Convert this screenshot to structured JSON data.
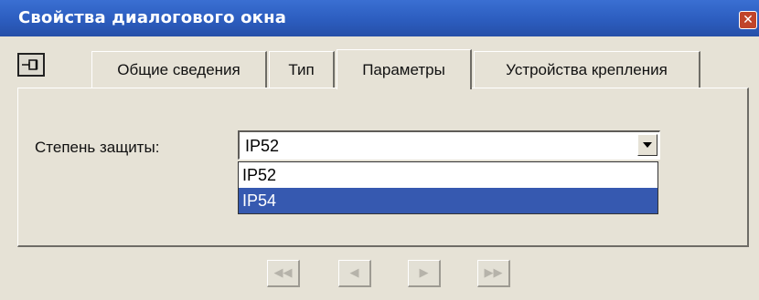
{
  "window": {
    "title": "Свойства диалогового окна",
    "close_icon": "close-icon",
    "pin_icon": "pin-icon"
  },
  "tabs": [
    {
      "label": "Общие сведения",
      "active": false
    },
    {
      "label": "Тип",
      "active": false
    },
    {
      "label": "Параметры",
      "active": true
    },
    {
      "label": "Устройства крепления",
      "active": false
    }
  ],
  "protection": {
    "label": "Степень защиты:",
    "value": "IP52",
    "options": [
      {
        "label": "IP52",
        "selected": false
      },
      {
        "label": "IP54",
        "selected": true
      }
    ]
  },
  "nav": {
    "first_icon": "first-icon",
    "prev_icon": "prev-icon",
    "next_icon": "next-icon",
    "last_icon": "last-icon"
  },
  "colors": {
    "titlebar": "#2c5dbf",
    "selection": "#3659b0",
    "close": "#c0442a"
  }
}
